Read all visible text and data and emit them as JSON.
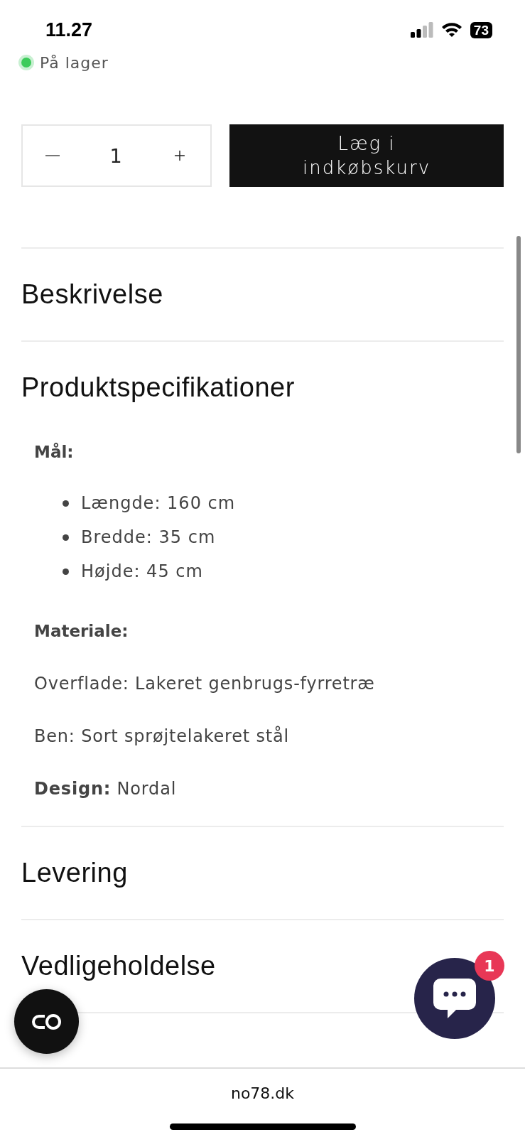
{
  "status_bar": {
    "time": "11.27",
    "battery": "73"
  },
  "stock": {
    "label": "På lager",
    "in_stock": true
  },
  "quantity": {
    "value": "1"
  },
  "cart_button": {
    "label": "Læg i indkøbskurv"
  },
  "accordion": [
    {
      "title": "Beskrivelse"
    },
    {
      "title": "Produktspecifikationer",
      "content": [
        {
          "kind": "heading",
          "text": "Mål:"
        },
        {
          "kind": "list",
          "items": [
            "Længde: 160 cm",
            "Bredde: 35 cm",
            "Højde: 45 cm"
          ]
        },
        {
          "kind": "heading",
          "text": "Materiale:"
        },
        {
          "kind": "paragraph",
          "text": "Overflade: Lakeret genbrugs-fyrretræ"
        },
        {
          "kind": "paragraph",
          "text": "Ben: Sort sprøjtelakeret stål"
        },
        {
          "kind": "paragraph",
          "text": "**Design:** Nordal"
        }
      ]
    },
    {
      "title": "Levering"
    },
    {
      "title": "Vedligeholdelse"
    }
  ],
  "chat": {
    "badge": "1"
  },
  "browser": {
    "url": "no78.dk"
  }
}
